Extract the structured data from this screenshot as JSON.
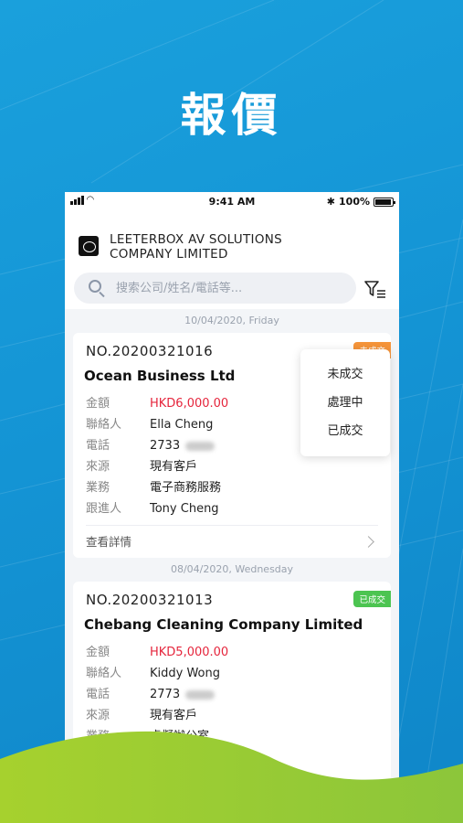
{
  "hero": {
    "title": "報價"
  },
  "statusbar": {
    "time": "9:41 AM",
    "battery": "100%"
  },
  "header": {
    "company": "LEETERBOX AV SOLUTIONS COMPANY LIMITED",
    "search_placeholder": "搜索公司/姓名/電話等..."
  },
  "filter_menu": {
    "options": [
      "未成交",
      "處理中",
      "已成交"
    ]
  },
  "groups": [
    {
      "date": "10/04/2020, Friday",
      "card": {
        "no": "NO.20200321016",
        "status": "未成交",
        "company": "Ocean Business Ltd",
        "fields": [
          {
            "label": "金額",
            "value": "HKD6,000.00"
          },
          {
            "label": "聯絡人",
            "value": "Ella Cheng"
          },
          {
            "label": "電話",
            "value": "2733"
          },
          {
            "label": "來源",
            "value": "現有客戶"
          },
          {
            "label": "業務",
            "value": "電子商務服務"
          },
          {
            "label": "跟進人",
            "value": "Tony Cheng"
          }
        ],
        "footer": "查看詳情"
      }
    },
    {
      "date": "08/04/2020, Wednesday",
      "card": {
        "no": "NO.20200321013",
        "status": "已成交",
        "company": "Chebang Cleaning Company Limited",
        "fields": [
          {
            "label": "金額",
            "value": "HKD5,000.00"
          },
          {
            "label": "聯絡人",
            "value": "Kiddy Wong"
          },
          {
            "label": "電話",
            "value": "2773"
          },
          {
            "label": "來源",
            "value": "現有客戶"
          },
          {
            "label": "業務",
            "value": "虛擬辦公室"
          }
        ]
      }
    }
  ],
  "colors": {
    "background": "#1596d6",
    "amount": "#e5253c",
    "badge_pending": "#f5943a",
    "badge_done": "#4cc451",
    "wave": "#9ccc2c"
  }
}
